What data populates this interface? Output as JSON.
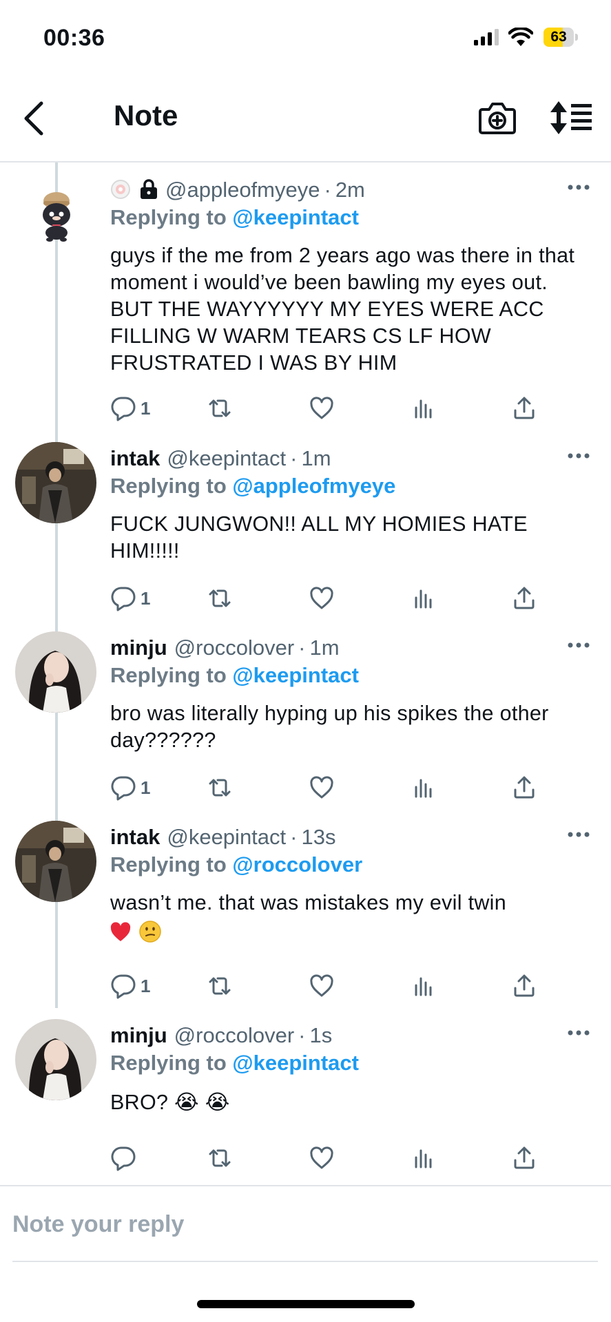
{
  "status_bar": {
    "time": "00:36",
    "battery_level": "63",
    "battery_fraction": 0.63
  },
  "header": {
    "title": "Note",
    "back_icon": "chevron-left-icon",
    "camera_icon": "camera-plus-icon",
    "sort_icon": "sort-icon"
  },
  "tweets": [
    {
      "name": "",
      "handle": "@appleofmyeye",
      "time": "2m",
      "replying_label": "Replying to",
      "replying_to": "@keepintact",
      "text": "guys if the me from 2 years ago was there in that moment i would’ve been bawling my eyes out. BUT THE WAYYYYYY MY EYES WERE ACC FILLING W WARM TEARS CS LF HOW FRUSTRATED I WAS BY HIM",
      "reply_count": "1",
      "protected": true
    },
    {
      "name": "intak",
      "handle": "@keepintact",
      "time": "1m",
      "replying_label": "Replying to",
      "replying_to": "@appleofmyeye",
      "text": "FUCK JUNGWON!! ALL MY HOMIES HATE HIM!!!!!",
      "reply_count": "1"
    },
    {
      "name": "minju",
      "handle": "@roccolover",
      "time": "1m",
      "replying_label": "Replying to",
      "replying_to": "@keepintact",
      "text": "bro was literally hyping up his spikes the other day??????",
      "reply_count": "1"
    },
    {
      "name": "intak",
      "handle": "@keepintact",
      "time": "13s",
      "replying_label": "Replying to",
      "replying_to": "@roccolover",
      "text": "wasn’t me. that was mistakes my evil twin",
      "emojis": "❤️ 😕",
      "reply_count": "1"
    },
    {
      "name": "minju",
      "handle": "@roccolover",
      "time": "1s",
      "replying_label": "Replying to",
      "replying_to": "@keepintact",
      "text": "BRO? 😭 😭",
      "reply_count": ""
    }
  ],
  "time_separator": "·",
  "reply_bar": {
    "placeholder": "Note your reply"
  },
  "colors": {
    "accent": "#1d9bf0",
    "text": "#0f1419",
    "secondary": "#536471",
    "battery": "#ffd60a"
  }
}
